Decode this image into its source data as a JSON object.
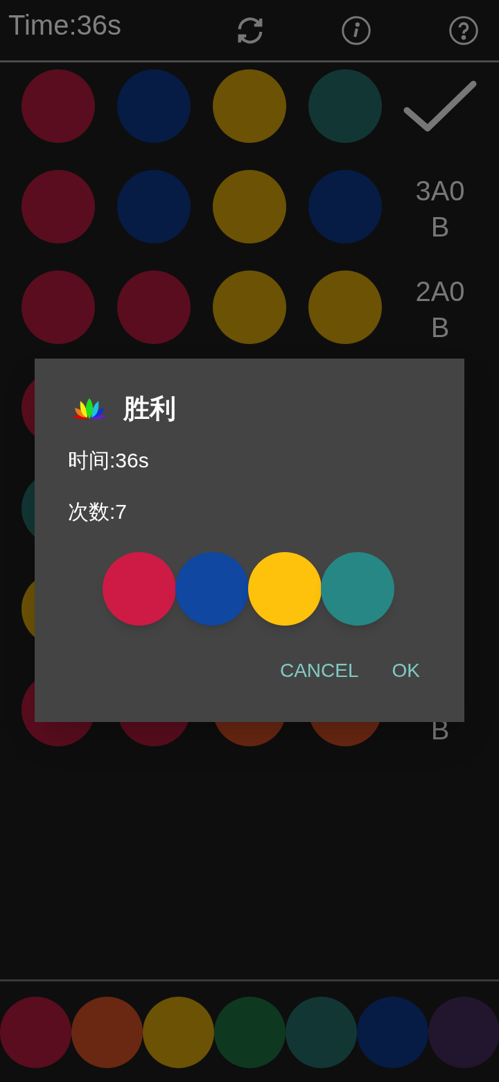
{
  "header": {
    "timer": "Time:36s"
  },
  "board": [
    {
      "pegs": [
        {
          "color": "#5a0d1e"
        },
        {
          "color": "#061c45"
        },
        {
          "color": "#6b5205"
        },
        {
          "color": "#123634"
        }
      ],
      "result": {
        "kind": "submit"
      }
    },
    {
      "pegs": [
        {
          "color": "#5a0d1e"
        },
        {
          "color": "#061c45"
        },
        {
          "color": "#6b5205"
        },
        {
          "color": "#061c45"
        }
      ],
      "result": {
        "kind": "hint",
        "lines": [
          "3A0",
          "B"
        ]
      }
    },
    {
      "pegs": [
        {
          "color": "#5a0d1e"
        },
        {
          "color": "#5a0d1e"
        },
        {
          "color": "#6b5205"
        },
        {
          "color": "#6b5205"
        }
      ],
      "result": {
        "kind": "hint",
        "lines": [
          "2A0",
          "B"
        ]
      }
    },
    {
      "pegs": [
        {
          "color": "#5a0d1e"
        }
      ]
    },
    {
      "pegs": [
        {
          "color": "#123634"
        }
      ]
    },
    {
      "pegs": [
        {
          "color": "#6b5205"
        }
      ]
    },
    {
      "pegs": [
        {
          "color": "#5a0d1e"
        },
        {
          "color": "#5a0d1e"
        },
        {
          "color": "#6a2712"
        },
        {
          "color": "#6a2712"
        }
      ],
      "result": {
        "kind": "hint",
        "lines": [
          "B"
        ]
      }
    }
  ],
  "palette": [
    {
      "color": "#5a0d1e"
    },
    {
      "color": "#6a2712"
    },
    {
      "color": "#6b5205"
    },
    {
      "color": "#0f3820"
    },
    {
      "color": "#123634"
    },
    {
      "color": "#061c45"
    },
    {
      "color": "#22162e"
    }
  ],
  "dialog": {
    "title": "胜利",
    "lines": [
      "时间:36s",
      "次数:7"
    ],
    "answer": [
      {
        "color": "#cd1b45"
      },
      {
        "color": "#0f47a1"
      },
      {
        "color": "#fec20c"
      },
      {
        "color": "#268784"
      }
    ],
    "buttons": [
      "CANCEL",
      "OK"
    ]
  }
}
